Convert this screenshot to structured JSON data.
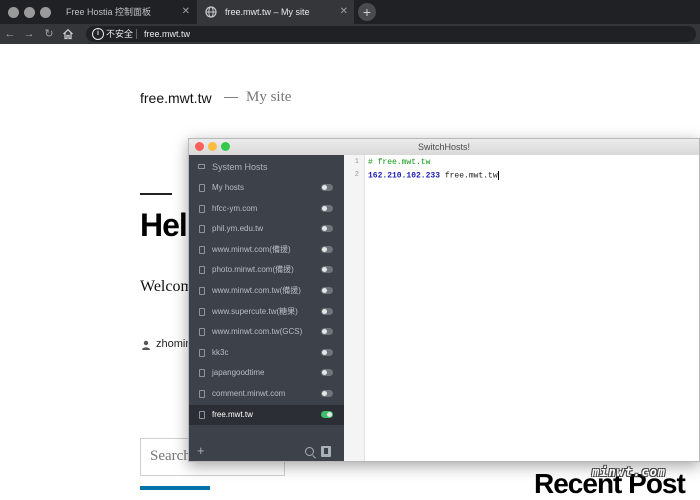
{
  "browser": {
    "tabs": [
      {
        "title": "Free Hostia 控制面板",
        "active": false
      },
      {
        "title": "free.mwt.tw – My site",
        "active": true
      }
    ],
    "new_tab_icon": "plus-icon",
    "address": {
      "security_label": "不安全",
      "url": "free.mwt.tw"
    }
  },
  "page": {
    "site_title": "free.mwt.tw",
    "dash": "—",
    "site_description": "My site",
    "post_heading": "Hel",
    "post_excerpt": "Welcom",
    "author": "zhomin",
    "search_placeholder": "Search",
    "recent_heading": "Recent Post"
  },
  "switchhosts": {
    "title": "SwitchHosts!",
    "system_hosts": "System Hosts",
    "items": [
      {
        "name": "My hosts",
        "on": false
      },
      {
        "name": "hfcc-ym.com",
        "on": false
      },
      {
        "name": "phil.ym.edu.tw",
        "on": false
      },
      {
        "name": "www.minwt.com(備援)",
        "on": false
      },
      {
        "name": "photo.minwt.com(備援)",
        "on": false
      },
      {
        "name": "www.minwt.com.tw(備援)",
        "on": false
      },
      {
        "name": "www.supercute.tw(糖果)",
        "on": false
      },
      {
        "name": "www.minwt.com.tw(GCS)",
        "on": false
      },
      {
        "name": "kk3c",
        "on": false
      },
      {
        "name": "japangoodtime",
        "on": false
      },
      {
        "name": "comment.minwt.com",
        "on": false
      },
      {
        "name": "free.mwt.tw",
        "on": true,
        "selected": true
      }
    ],
    "editor": {
      "line_numbers": [
        "1",
        "2"
      ],
      "line1_comment": "# free.mwt.tw",
      "line2_ip": "162.210.102.233",
      "line2_host": "free.mwt.tw"
    },
    "colors": {
      "sidebar": "#3d4149",
      "toggle_on": "#3ec06a",
      "comment": "#119911",
      "ip": "#1c1cb4"
    }
  },
  "watermark": "minwt.com"
}
